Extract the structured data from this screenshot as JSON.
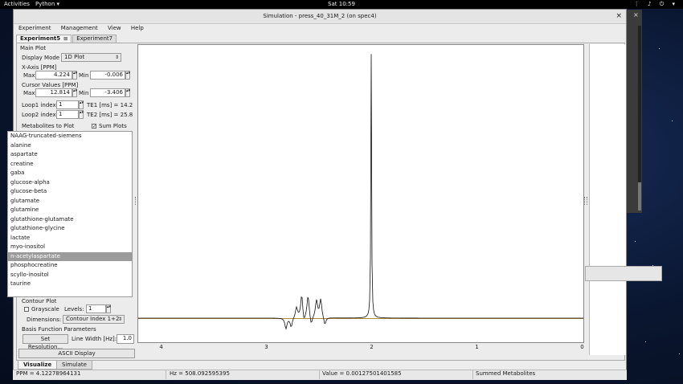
{
  "topbar": {
    "activities": "Activities",
    "app": "Python ▾",
    "clock": "Sat 10:59",
    "system_icons": "⋮ ♪ ⏻ ▾"
  },
  "window": {
    "title": "Simulation - press_40_31M_2 (on spec4)",
    "close": "×",
    "menu": [
      "Experiment",
      "Management",
      "View",
      "Help"
    ],
    "tabs": [
      {
        "label": "Experiment5",
        "close": "⊠"
      },
      {
        "label": "Experiment7"
      }
    ]
  },
  "main_plot": {
    "heading": "Main Plot",
    "display_mode_label": "Display Mode",
    "display_mode_value": "1D Plot",
    "xaxis_heading": "X-Axis [PPM]",
    "xaxis_max_label": "Max",
    "xaxis_max": "4.224",
    "xaxis_min_label": "Min",
    "xaxis_min": "-0.006",
    "cursor_heading": "Cursor Values [PPM]",
    "cursor_max_label": "Max",
    "cursor_max": "12.814",
    "cursor_min_label": "Min",
    "cursor_min": "-3.406",
    "loop1_label": "Loop1 index:",
    "loop1_value": "1",
    "te1": "TE1 [ms] = 14.2",
    "loop2_label": "Loop2 index:",
    "loop2_value": "1",
    "te2": "TE2 [ms] = 25.8",
    "metabolites_heading": "Metabolites to Plot",
    "sum_plots_label": "Sum Plots",
    "sum_plots_checked": true
  },
  "metabolites": [
    "NAAG-truncated-siemens",
    "alanine",
    "aspartate",
    "creatine",
    "gaba",
    "glucose-alpha",
    "glucose-beta",
    "glutamate",
    "glutamine",
    "glutathione-glutamate",
    "glutathione-glycine",
    "lactate",
    "myo-inositol",
    "n-acetylaspartate",
    "phosphocreatine",
    "scyllo-inositol",
    "taurine"
  ],
  "selected_metabolite": "n-acetylaspartate",
  "contour": {
    "heading": "Contour Plot",
    "grayscale_label": "Grayscale",
    "levels_label": "Levels:",
    "levels_value": "1",
    "dimensions_label": "Dimensions:",
    "dimensions_value": "Contour Index 1+2"
  },
  "basis": {
    "heading": "Basis Function Parameters",
    "resolution_button": "Set Resolution...",
    "linewidth_label": "Line Width [Hz]:",
    "linewidth_value": "1.0",
    "ascii_button": "ASCII Display"
  },
  "bottom_tabs": [
    "Visualize",
    "Simulate"
  ],
  "status": {
    "ppm": "PPM = 4.12278964131",
    "hz": "Hz = 508.092595395",
    "value": "Value = 0.00127501401585",
    "label": "Summed Metabolites"
  },
  "chart_data": {
    "type": "line",
    "xlabel": "",
    "ylabel": "",
    "xlim": [
      4.224,
      -0.006
    ],
    "x_ticks": [
      "4",
      "3",
      "2",
      "1",
      "0"
    ],
    "series": [
      {
        "color": "#111111",
        "peaks": [
          {
            "ppm": 2.01,
            "height": 1.0
          },
          {
            "ppm": 2.67,
            "height": 0.09
          },
          {
            "ppm": 2.61,
            "height": 0.085
          },
          {
            "ppm": 2.53,
            "height": 0.065
          },
          {
            "ppm": 2.49,
            "height": 0.07
          },
          {
            "ppm": 2.82,
            "height": -0.04
          },
          {
            "ppm": 2.77,
            "height": -0.035
          },
          {
            "ppm": 2.72,
            "height": 0.04
          },
          {
            "ppm": 2.65,
            "height": -0.03
          },
          {
            "ppm": 2.58,
            "height": -0.035
          },
          {
            "ppm": 2.45,
            "height": -0.03
          }
        ]
      }
    ],
    "baseline_color": "#b08a3a"
  }
}
